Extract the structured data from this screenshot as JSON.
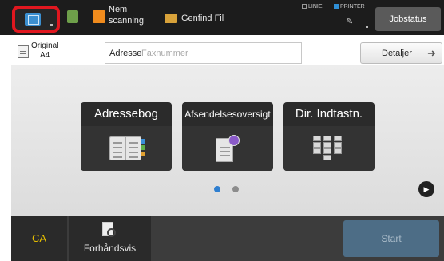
{
  "topbar": {
    "scan_label": "Nem\nscanning",
    "scan_line1": "Nem",
    "scan_line2": "scanning",
    "folder_label": "Genfind Fil",
    "linie_label": "LINIE",
    "printer_label": "PRINTER",
    "jobstatus_label": "Jobstatus"
  },
  "address_row": {
    "original_label": "Original",
    "original_size": "A4",
    "address_label": "Adresse",
    "address_placeholder": "Faxnummer",
    "details_label": "Detaljer"
  },
  "tiles": [
    {
      "label": "Adressebog",
      "icon": "address-book-icon"
    },
    {
      "label": "Afsendelsesoversigt",
      "icon": "send-history-icon"
    },
    {
      "label": "Dir. Indtastn.",
      "icon": "keypad-icon"
    }
  ],
  "pager": {
    "pages": 2,
    "current": 1
  },
  "bottombar": {
    "ca_label": "CA",
    "preview_label": "Forhåndsvis",
    "start_label": "Start"
  },
  "colors": {
    "home_highlight": "#e0171f",
    "ca_text": "#e8c000",
    "pager_active": "#2f7fd0",
    "start_button": "#4d6d86"
  }
}
